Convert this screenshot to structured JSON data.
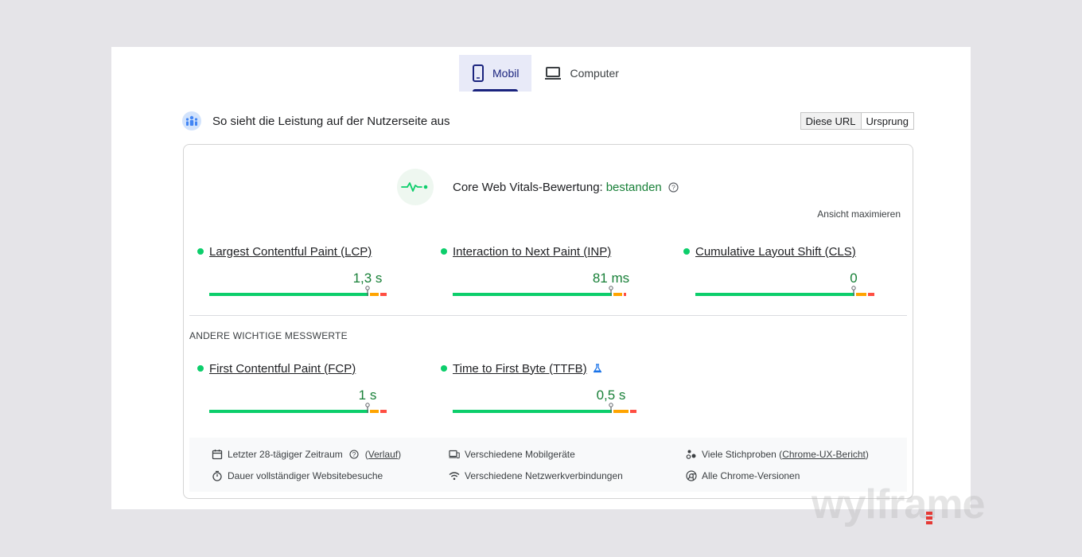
{
  "tabs": [
    {
      "label": "Mobil",
      "active": true,
      "icon": "smartphone-icon"
    },
    {
      "label": "Computer",
      "active": false,
      "icon": "laptop-icon"
    }
  ],
  "header": {
    "title": "So sieht die Leistung auf der Nutzerseite aus",
    "icon": "crux-people-icon",
    "toggle": [
      "Diese URL",
      "Ursprung"
    ]
  },
  "cwv": {
    "title": "Core Web Vitals-Bewertung:",
    "status": "bestanden",
    "status_color": "#188038",
    "expand_label": "Ansicht maximieren"
  },
  "colors": {
    "good": "#0cce6b",
    "needs_improvement": "#ffa400",
    "poor": "#ff4e42",
    "value_text": "#188038"
  },
  "core_metrics": [
    {
      "name": "Largest Contentful Paint (LCP)",
      "value": "1,3 s",
      "good_pct": 0.75,
      "ni_pct": 0.04,
      "poor_pct": 0.03
    },
    {
      "name": "Interaction to Next Paint (INP)",
      "value": "81 ms",
      "good_pct": 0.75,
      "ni_pct": 0.04,
      "poor_pct": 0.01
    },
    {
      "name": "Cumulative Layout Shift (CLS)",
      "value": "0",
      "good_pct": 0.75,
      "ni_pct": 0.05,
      "poor_pct": 0.03
    }
  ],
  "other_heading": "ANDERE WICHTIGE MESSWERTE",
  "other_metrics": [
    {
      "name": "First Contentful Paint (FCP)",
      "value": "1 s",
      "good_pct": 0.75,
      "ni_pct": 0.04,
      "poor_pct": 0.03,
      "experimental": false
    },
    {
      "name": "Time to First Byte (TTFB)",
      "value": "0,5 s",
      "good_pct": 0.75,
      "ni_pct": 0.07,
      "poor_pct": 0.03,
      "experimental": true
    }
  ],
  "footer": {
    "period": "Letzter 28-tägiger Zeitraum",
    "history_link": "Verlauf",
    "visits": "Dauer vollständiger Websitebesuche",
    "devices": "Verschiedene Mobilgeräte",
    "network": "Verschiedene Netzwerkverbindungen",
    "samples_prefix": "Viele Stichproben",
    "samples_link": "Chrome-UX-Bericht",
    "versions": "Alle Chrome-Versionen"
  },
  "watermark": "wylframe"
}
